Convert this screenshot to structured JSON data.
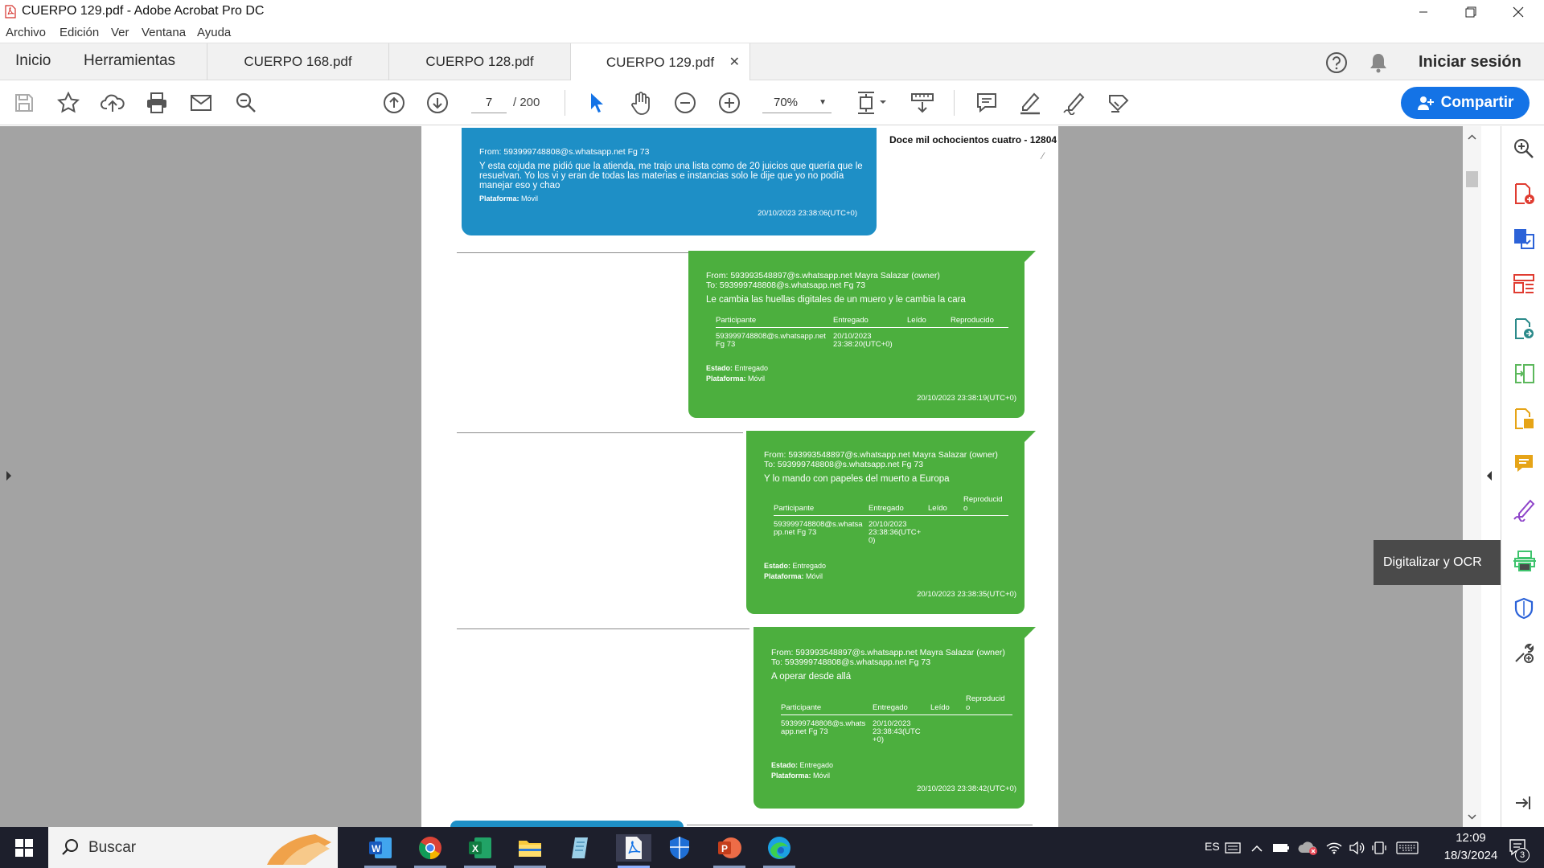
{
  "window": {
    "title": "CUERPO 129.pdf - Adobe Acrobat Pro DC",
    "app_icon": "pdf-icon"
  },
  "menu": [
    "Archivo",
    "Edición",
    "Ver",
    "Ventana",
    "Ayuda"
  ],
  "nav_tabs": [
    "Inicio",
    "Herramientas"
  ],
  "doc_tabs": [
    {
      "label": "CUERPO 168.pdf",
      "active": false
    },
    {
      "label": "CUERPO 128.pdf",
      "active": false
    },
    {
      "label": "CUERPO 129.pdf",
      "active": true
    }
  ],
  "header_right": {
    "signin": "Iniciar sesión"
  },
  "toolbar": {
    "page_current": "7",
    "page_total": "/ 200",
    "zoom": "70%",
    "share_label": "Compartir"
  },
  "document": {
    "header_text": "Doce mil ochocientos cuatro - 12804",
    "messages": [
      {
        "from": "From: 593999748808@s.whatsapp.net Fg 73",
        "to": "",
        "body": "Y esta cojuda me pidió que la atienda, me trajo una lista como de 20 juicios que quería que le resuelvan. Yo los vi y eran de todas las materias e instancias solo le dije que yo no podía manejar eso y chao",
        "platform_label": "Plataforma:",
        "platform": "Móvil",
        "timestamp": "20/10/2023 23:38:06(UTC+0)",
        "color": "#1e8fc6"
      },
      {
        "from": "From: 593993548897@s.whatsapp.net Mayra Salazar (owner)",
        "to": "To: 593999748808@s.whatsapp.net Fg 73",
        "body": "Le cambia las huellas digitales de un muero y le cambia la cara",
        "table_headers": [
          "Participante",
          "Entregado",
          "Leído",
          "Reproducido"
        ],
        "table_row": [
          "593999748808@s.whatsapp.net Fg 73",
          "20/10/2023 23:38:20(UTC+0)",
          "",
          ""
        ],
        "status_label": "Estado:",
        "status": "Entregado",
        "platform_label": "Plataforma:",
        "platform": "Móvil",
        "timestamp": "20/10/2023 23:38:19(UTC+0)",
        "color": "#4caf3e"
      },
      {
        "from": "From: 593993548897@s.whatsapp.net Mayra Salazar (owner)",
        "to": "To: 593999748808@s.whatsapp.net Fg 73",
        "body": "Y lo mando con papeles del muerto a Europa",
        "table_headers": [
          "Participante",
          "Entregado",
          "Leído",
          "Reproducid o"
        ],
        "table_row": [
          "593999748808@s.whatsa pp.net Fg 73",
          "20/10/2023 23:38:36(UTC+ 0)",
          "",
          ""
        ],
        "status_label": "Estado:",
        "status": "Entregado",
        "platform_label": "Plataforma:",
        "platform": "Móvil",
        "timestamp": "20/10/2023 23:38:35(UTC+0)",
        "color": "#4caf3e"
      },
      {
        "from": "From: 593993548897@s.whatsapp.net Mayra Salazar (owner)",
        "to": "To: 593999748808@s.whatsapp.net Fg 73",
        "body": "A operar desde allá",
        "table_headers": [
          "Participante",
          "Entregado",
          "Leído",
          "Reproducid o"
        ],
        "table_row": [
          "593999748808@s.whats app.net Fg 73",
          "20/10/2023 23:38:43(UTC +0)",
          "",
          ""
        ],
        "status_label": "Estado:",
        "status": "Entregado",
        "platform_label": "Plataforma:",
        "platform": "Móvil",
        "timestamp": "20/10/2023 23:38:42(UTC+0)",
        "color": "#4caf3e"
      }
    ]
  },
  "right_panel": {
    "tooltip": "Digitalizar y OCR",
    "tools": [
      "zoom-icon",
      "create-pdf-icon",
      "export-pdf-icon",
      "organize-pages-icon",
      "edit-pdf-icon",
      "compare-icon",
      "combine-icon",
      "comment-icon",
      "fill-sign-icon",
      "scan-ocr-icon",
      "protect-icon",
      "more-tools-icon"
    ]
  },
  "taskbar": {
    "search_placeholder": "Buscar",
    "apps": [
      "word-icon",
      "chrome-icon",
      "excel-icon",
      "file-explorer-icon",
      "notepad-icon",
      "acrobat-icon",
      "defender-icon",
      "powerpoint-icon",
      "edge-icon"
    ],
    "language": "ES",
    "time": "12:09",
    "date": "18/3/2024",
    "notifications": "3"
  },
  "colors": {
    "accent": "#1473e6",
    "msg_blue": "#1e8fc6",
    "msg_green": "#4caf3e",
    "doc_bg": "#a3a3a3",
    "taskbar": "#1d1f2c"
  }
}
